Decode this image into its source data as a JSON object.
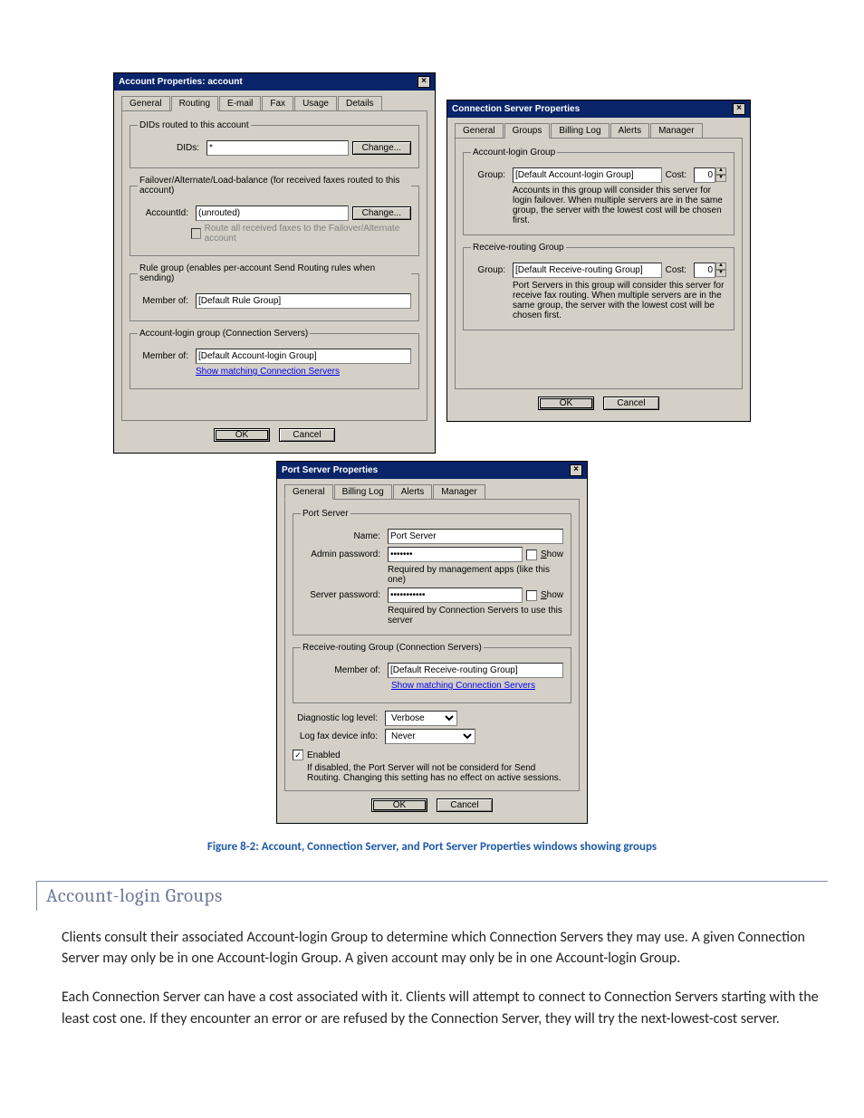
{
  "account_props": {
    "title": "Account Properties: account",
    "tabs": [
      "General",
      "Routing",
      "E-mail",
      "Fax",
      "Usage",
      "Details"
    ],
    "fs1_legend": "DIDs routed to this account",
    "dids_label": "DIDs:",
    "dids_value": "*",
    "change_btn": "Change...",
    "fs2_legend": "Failover/Alternate/Load-balance (for received faxes routed to this account)",
    "accountid_label": "AccountId:",
    "accountid_value": "(unrouted)",
    "routeall_chk": "Route all received faxes to the Failover/Alternate account",
    "fs3_legend": "Rule group (enables per-account Send Routing rules when sending)",
    "memberof_label": "Member of:",
    "rulegroup_value": "[Default Rule Group]",
    "fs4_legend": "Account-login group (Connection Servers)",
    "logingroup_value": "[Default Account-login Group]",
    "show_conn_link": "Show matching Connection Servers",
    "ok": "OK",
    "cancel": "Cancel"
  },
  "conn_srv": {
    "title": "Connection Server Properties",
    "tabs": [
      "General",
      "Groups",
      "Billing Log",
      "Alerts",
      "Manager"
    ],
    "fs1_legend": "Account-login Group",
    "group_label": "Group:",
    "group1_value": "[Default Account-login Group]",
    "cost_label": "Cost:",
    "cost_value": "0",
    "note1": "Accounts in this group will consider this server for login failover.  When multiple servers are in the same group, the server with the lowest cost will be chosen first.",
    "fs2_legend": "Receive-routing Group",
    "group2_value": "[Default Receive-routing Group]",
    "note2": "Port Servers in this group will consider this server for receive fax routing.  When multiple servers are in the same group, the server with the lowest cost will be chosen first.",
    "ok": "OK",
    "cancel": "Cancel"
  },
  "port_srv": {
    "title": "Port Server Properties",
    "tabs": [
      "General",
      "Billing Log",
      "Alerts",
      "Manager"
    ],
    "fs1_legend": "Port Server",
    "name_label": "Name:",
    "name_value": "Port Server",
    "adminpw_label": "Admin password:",
    "adminpw_value": "•••••••",
    "show_btn": "Show",
    "adminpw_note": "Required by management apps (like this one)",
    "srvpw_label": "Server password:",
    "srvpw_value": "•••••••••••",
    "srvpw_note": "Required by Connection Servers to use this server",
    "fs2_legend": "Receive-routing Group (Connection Servers)",
    "memberof_label": "Member of:",
    "memberof_value": "[Default Receive-routing Group]",
    "show_link": "Show matching Connection Servers",
    "diag_label": "Diagnostic log level:",
    "diag_value": "Verbose",
    "logfax_label": "Log fax device info:",
    "logfax_value": "Never",
    "enabled_chk": "Enabled",
    "enabled_note": "If disabled, the Port Server will not be considerd for Send Routing. Changing this setting has no effect on active sessions.",
    "ok": "OK",
    "cancel": "Cancel"
  },
  "doc": {
    "figure_caption": "Figure 8-2: Account, Connection Server, and Port Server Properties windows showing groups",
    "heading": "Account-login Groups",
    "para1": "Clients consult their associated Account-login Group to determine which Connection Servers they may use. A given Connection Server may only be in one Account-login Group. A given account may only be in one Account-login Group.",
    "para2": "Each Connection Server can have a cost associated with it. Clients will attempt to connect to Connection Servers starting with the least cost one. If they encounter an error or are refused by the Connection Server, they will try the next-lowest-cost server."
  }
}
